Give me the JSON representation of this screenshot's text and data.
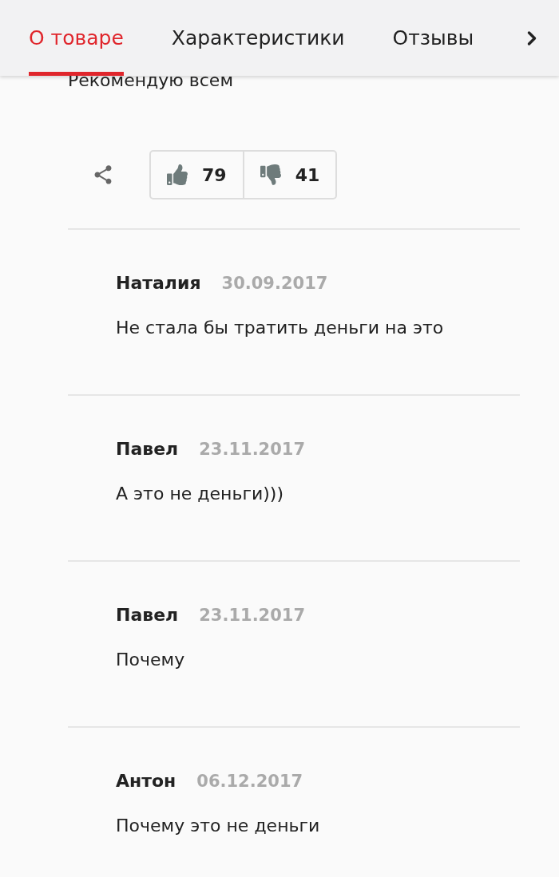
{
  "tabs": [
    {
      "label": "О товаре",
      "selected": true
    },
    {
      "label": "Характеристики",
      "selected": false
    },
    {
      "label": "Отзывы",
      "selected": false
    }
  ],
  "review_text": "Рекомендую всем",
  "votes": {
    "up": "79",
    "down": "41"
  },
  "comments": [
    {
      "author": "Наталия",
      "date": "30.09.2017",
      "text": "Не стала бы тратить деньги на это"
    },
    {
      "author": "Павел",
      "date": "23.11.2017",
      "text": "А это не деньги)))"
    },
    {
      "author": "Павел",
      "date": "23.11.2017",
      "text": "Почему"
    },
    {
      "author": "Антон",
      "date": "06.12.2017",
      "text": "Почему это не деньги"
    }
  ]
}
